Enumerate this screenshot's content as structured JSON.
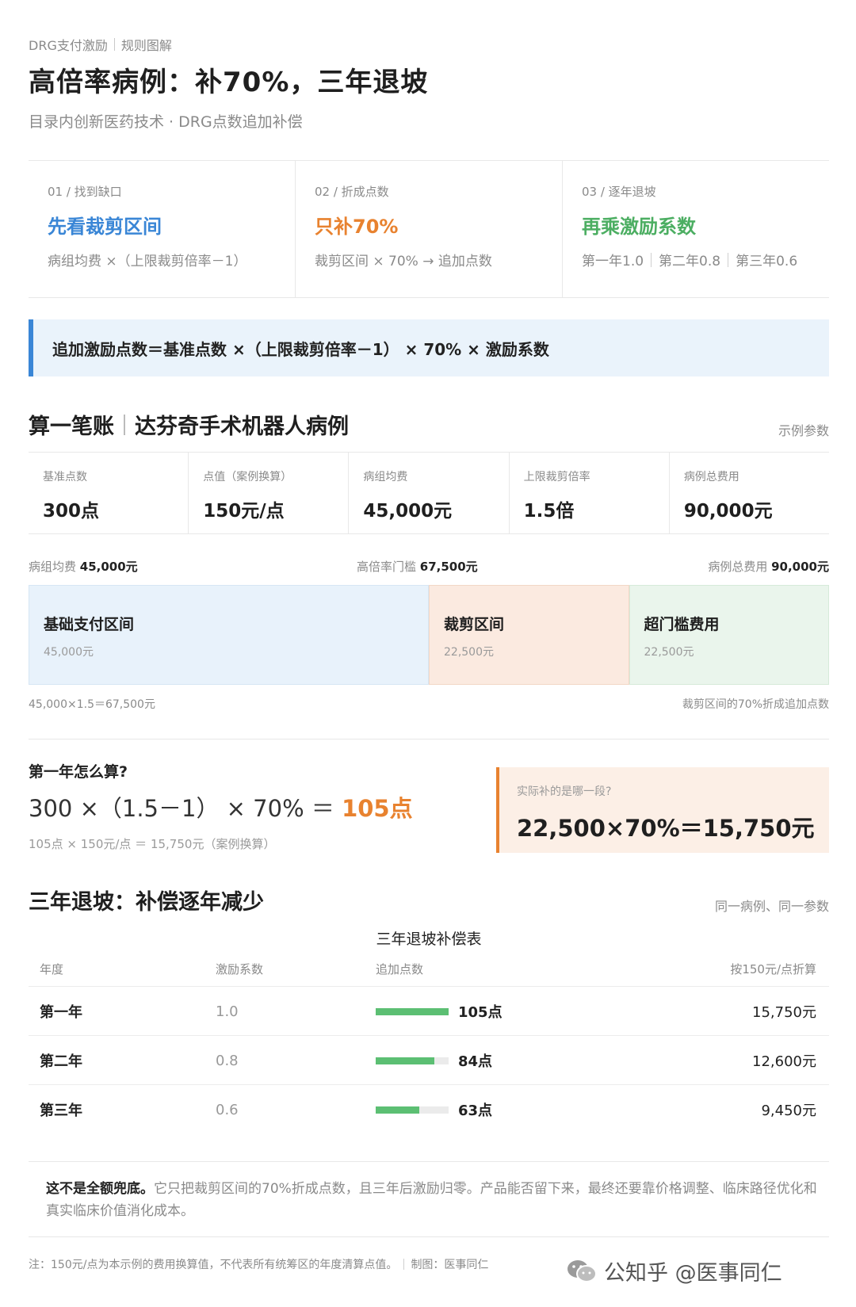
{
  "header": {
    "eyebrow_left": "DRG支付激励",
    "eyebrow_right": "规则图解",
    "title": "高倍率病例：补70%，三年退坡",
    "subtitle": "目录内创新医药技术 · DRG点数追加补偿"
  },
  "steps": [
    {
      "kicker": "01 / 找到缺口",
      "heading": "先看裁剪区间",
      "color": "#3a86d6",
      "desc": "病组均费 ×（上限裁剪倍率－1）"
    },
    {
      "kicker": "02 / 折成点数",
      "heading": "只补70%",
      "color": "#e8822f",
      "desc": "裁剪区间 × 70% → 追加点数"
    },
    {
      "kicker": "03 / 逐年退坡",
      "heading": "再乘激励系数",
      "color": "#4cae62",
      "desc_parts": [
        "第一年1.0",
        "第二年0.8",
        "第三年0.6"
      ]
    }
  ],
  "formula": "追加激励点数＝基准点数 ×（上限裁剪倍率－1） × 70% × 激励系数",
  "case": {
    "title_left": "算一笔账",
    "title_right": "达芬奇手术机器人病例",
    "note": "示例参数",
    "params": [
      {
        "label": "基准点数",
        "value": "300点"
      },
      {
        "label": "点值（案例换算）",
        "value": "150元/点"
      },
      {
        "label": "病组均费",
        "value": "45,000元"
      },
      {
        "label": "上限裁剪倍率",
        "value": "1.5倍"
      },
      {
        "label": "病例总费用",
        "value": "90,000元"
      }
    ]
  },
  "cost_bar": {
    "labels": [
      {
        "prefix": "病组均费",
        "value": "45,000元"
      },
      {
        "prefix": "高倍率门槛",
        "value": "67,500元"
      },
      {
        "prefix": "病例总费用",
        "value": "90,000元"
      }
    ],
    "segments": [
      {
        "name": "基础支付区间",
        "amount": "45,000元",
        "amount_num": 45000
      },
      {
        "name": "裁剪区间",
        "amount": "22,500元",
        "amount_num": 22500
      },
      {
        "name": "超门槛费用",
        "amount": "22,500元",
        "amount_num": 22500
      }
    ],
    "foot_left": "45,000×1.5＝67,500元",
    "foot_right": "裁剪区间的70%折成追加点数"
  },
  "calc": {
    "question": "第一年怎么算?",
    "equation": "300 ×（1.5－1） × 70% ＝ ",
    "result": "105点",
    "sub": "105点 × 150元/点 ＝ 15,750元（案例换算）",
    "callout_q": "实际补的是哪一段?",
    "callout_a": "22,500×70%＝15,750元"
  },
  "taper": {
    "title": "三年退坡：补偿逐年减少",
    "note": "同一病例、同一参数",
    "table_title": "三年退坡补偿表",
    "headers": [
      "年度",
      "激励系数",
      "追加点数",
      "按150元/点折算"
    ],
    "rows": [
      {
        "year": "第一年",
        "coef": "1.0",
        "points": "105点",
        "points_num": 105,
        "amount": "15,750元"
      },
      {
        "year": "第二年",
        "coef": "0.8",
        "points": "84点",
        "points_num": 84,
        "amount": "12,600元"
      },
      {
        "year": "第三年",
        "coef": "0.6",
        "points": "63点",
        "points_num": 63,
        "amount": "9,450元"
      }
    ],
    "bar_max": 105
  },
  "conclusion": {
    "bold": "这不是全额兜底。",
    "text": "它只把裁剪区间的70%折成点数，且三年后激励归零。产品能否留下来，最终还要靠价格调整、临床路径优化和真实临床价值消化成本。"
  },
  "footer": {
    "note": "注：150元/点为本示例的费用换算值，不代表所有统筹区的年度清算点值。",
    "credit": "制图：医事同仁",
    "watermark": "公知乎 @医事同仁"
  }
}
